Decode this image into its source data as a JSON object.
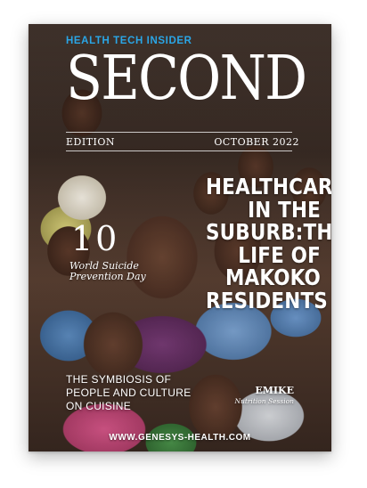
{
  "cover": {
    "brand": "HEALTH TECH INSIDER",
    "masthead": "SECOND",
    "edition_label": "EDITION",
    "issue_date": "OCTOBER 2022",
    "headline": "HEALTHCARE IN THE SUBURB:THE LIFE OF MAKOKO RESIDENTS",
    "feature_number": "10",
    "feature_caption": "World Suicide Prevention Day",
    "story_left": "THE SYMBIOSIS OF PEOPLE AND CULTURE ON CUISINE",
    "story_right_title": "EMIKE",
    "story_right_subtitle": "Nutrition Session",
    "website": "WWW.GENESYS-HEALTH.COM"
  },
  "colors": {
    "brand_accent": "#2aa6e6",
    "text": "#ffffff"
  }
}
